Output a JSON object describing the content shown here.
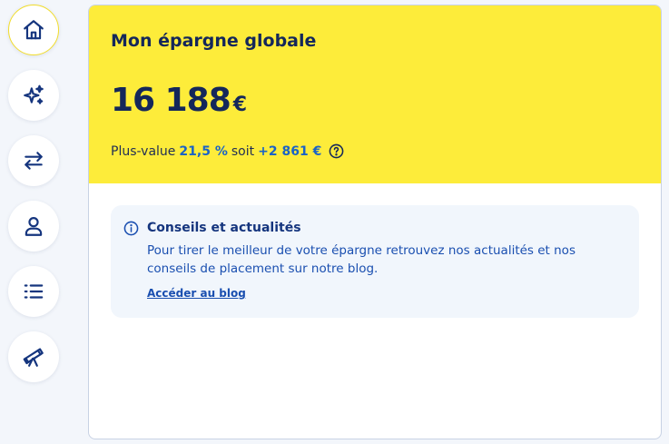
{
  "colors": {
    "accent_yellow": "#fdec3a",
    "navy": "#14275a",
    "blue": "#1a63c6",
    "info_bg": "#f1f6fc"
  },
  "sidebar": {
    "items": [
      {
        "icon": "home-icon",
        "active": true
      },
      {
        "icon": "sparkles-icon",
        "active": false
      },
      {
        "icon": "transfer-arrows-icon",
        "active": false
      },
      {
        "icon": "user-icon",
        "active": false
      },
      {
        "icon": "list-icon",
        "active": false
      },
      {
        "icon": "telescope-icon",
        "active": false
      }
    ]
  },
  "summary": {
    "title": "Mon épargne globale",
    "amount": "16 188",
    "currency": "€",
    "gain_label": "Plus-value",
    "gain_percent": "21,5 %",
    "gain_connector": "soit",
    "gain_amount": "+2 861 €",
    "help_icon": "question-circle-icon"
  },
  "info": {
    "icon": "info-circle-icon",
    "title": "Conseils et actualités",
    "text": "Pour tirer le meilleur de votre épargne retrouvez nos actualités et nos conseils de placement sur notre blog.",
    "link": "Accéder au blog"
  }
}
